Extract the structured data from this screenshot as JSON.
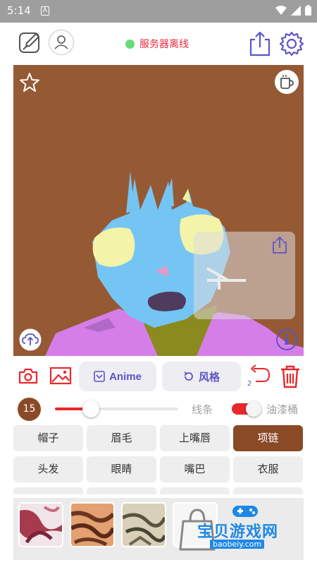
{
  "status_bar": {
    "time": "5:14",
    "notification_letter": "A"
  },
  "top_bar": {
    "server_status_text": "服务器离线",
    "server_status_color": "#66dd77"
  },
  "tools": {
    "anime_label": "Anime",
    "style_label": "风格",
    "undo_count": "2"
  },
  "brush": {
    "size": "15",
    "slider_fraction": 0.29,
    "lines_label": "线条",
    "bucket_label": "油漆桶",
    "bucket_enabled": true
  },
  "parts": [
    {
      "label": "帽子",
      "selected": false
    },
    {
      "label": "眉毛",
      "selected": false
    },
    {
      "label": "上嘴唇",
      "selected": false
    },
    {
      "label": "项链",
      "selected": true
    },
    {
      "label": "头发",
      "selected": false
    },
    {
      "label": "眼睛",
      "selected": false
    },
    {
      "label": "嘴巴",
      "selected": false
    },
    {
      "label": "衣服",
      "selected": false
    }
  ],
  "watermark": {
    "text": "宝贝游戏网",
    "url": "baobeiy.com"
  },
  "colors": {
    "accent_red": "#e8282c",
    "brand_purple": "#5b55c6",
    "canvas_brown": "#955934",
    "selected_brown": "#8a4a26"
  }
}
